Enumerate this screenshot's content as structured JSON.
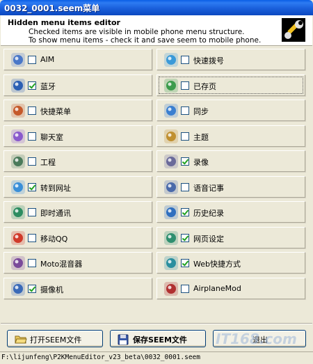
{
  "window": {
    "title": "0032_0001.seem菜单"
  },
  "header": {
    "title": "Hidden menu items editor",
    "line1": "Checked items are visible in mobile phone menu structure.",
    "line2": "To show menu items - check it and save seem to mobile phone.",
    "icon": "wrench-icon"
  },
  "items": [
    {
      "label": "AIM",
      "checked": false,
      "icon": "aim-icon"
    },
    {
      "label": "快速拨号",
      "checked": false,
      "icon": "speed-dial-icon"
    },
    {
      "label": "蓝牙",
      "checked": true,
      "icon": "bluetooth-icon"
    },
    {
      "label": "已存页",
      "checked": false,
      "icon": "saved-pages-icon"
    },
    {
      "label": "快捷菜单",
      "checked": false,
      "icon": "shortcut-menu-icon"
    },
    {
      "label": "同步",
      "checked": false,
      "icon": "sync-icon"
    },
    {
      "label": "聊天室",
      "checked": false,
      "icon": "chat-room-icon"
    },
    {
      "label": "主题",
      "checked": false,
      "icon": "theme-icon"
    },
    {
      "label": "工程",
      "checked": false,
      "icon": "engineering-icon"
    },
    {
      "label": "录像",
      "checked": true,
      "icon": "video-record-icon"
    },
    {
      "label": "转到网址",
      "checked": true,
      "icon": "goto-url-icon"
    },
    {
      "label": "语音记事",
      "checked": false,
      "icon": "voice-note-icon"
    },
    {
      "label": "即时通讯",
      "checked": false,
      "icon": "instant-messaging-icon"
    },
    {
      "label": "历史纪录",
      "checked": true,
      "icon": "history-icon"
    },
    {
      "label": "移动QQ",
      "checked": false,
      "icon": "mobile-qq-icon"
    },
    {
      "label": "网页设定",
      "checked": true,
      "icon": "web-settings-icon"
    },
    {
      "label": "Moto混音器",
      "checked": false,
      "icon": "moto-mixer-icon"
    },
    {
      "label": "Web快捷方式",
      "checked": true,
      "icon": "web-shortcut-icon"
    },
    {
      "label": "摄像机",
      "checked": true,
      "icon": "camera-icon"
    },
    {
      "label": "AirplaneMod",
      "checked": false,
      "icon": "airplane-mode-icon"
    }
  ],
  "buttons": {
    "open": "打开SEEM文件",
    "save": "保存SEEM文件",
    "exit": "退出"
  },
  "status": {
    "path": "F:\\lijunfeng\\P2KMenuEditor_v23_beta\\0032_0001.seem"
  },
  "colors": {
    "titlebar": "#0a5ee6",
    "face": "#ece9d8",
    "check": "#21a121"
  }
}
